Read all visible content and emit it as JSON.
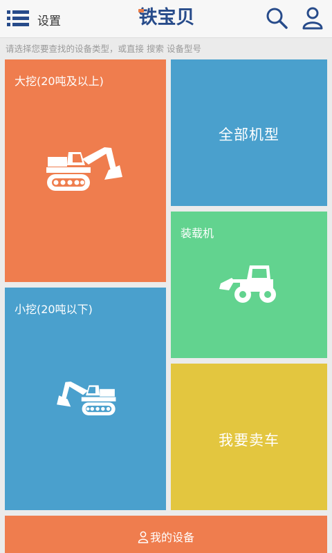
{
  "header": {
    "menu_label": "设置",
    "brand": "铁宝贝",
    "menu_icon": "list-icon",
    "search_icon": "search-icon",
    "user_icon": "user-icon"
  },
  "hint": "请选择您要查找的设备类型，或直接 搜索 设备型号",
  "tiles": {
    "big_excavator": {
      "label": "大挖(20吨及以上)",
      "icon": "excavator-icon",
      "color": "#ef7d4e"
    },
    "all_models": {
      "label": "全部机型",
      "color": "#4aa0cd"
    },
    "loader": {
      "label": "装载机",
      "icon": "wheel-loader-icon",
      "color": "#62d38f"
    },
    "small_excavator": {
      "label": "小挖(20吨以下)",
      "icon": "excavator-icon",
      "color": "#4aa0cd"
    },
    "sell_car": {
      "label": "我要卖车",
      "color": "#e3c63f"
    },
    "my_equipment": {
      "label": "我的设备",
      "icon": "person-icon",
      "color": "#ef7d4e"
    }
  },
  "colors": {
    "brand_blue": "#274b8a",
    "brand_accent": "#e97a45",
    "background": "#ebebeb"
  }
}
